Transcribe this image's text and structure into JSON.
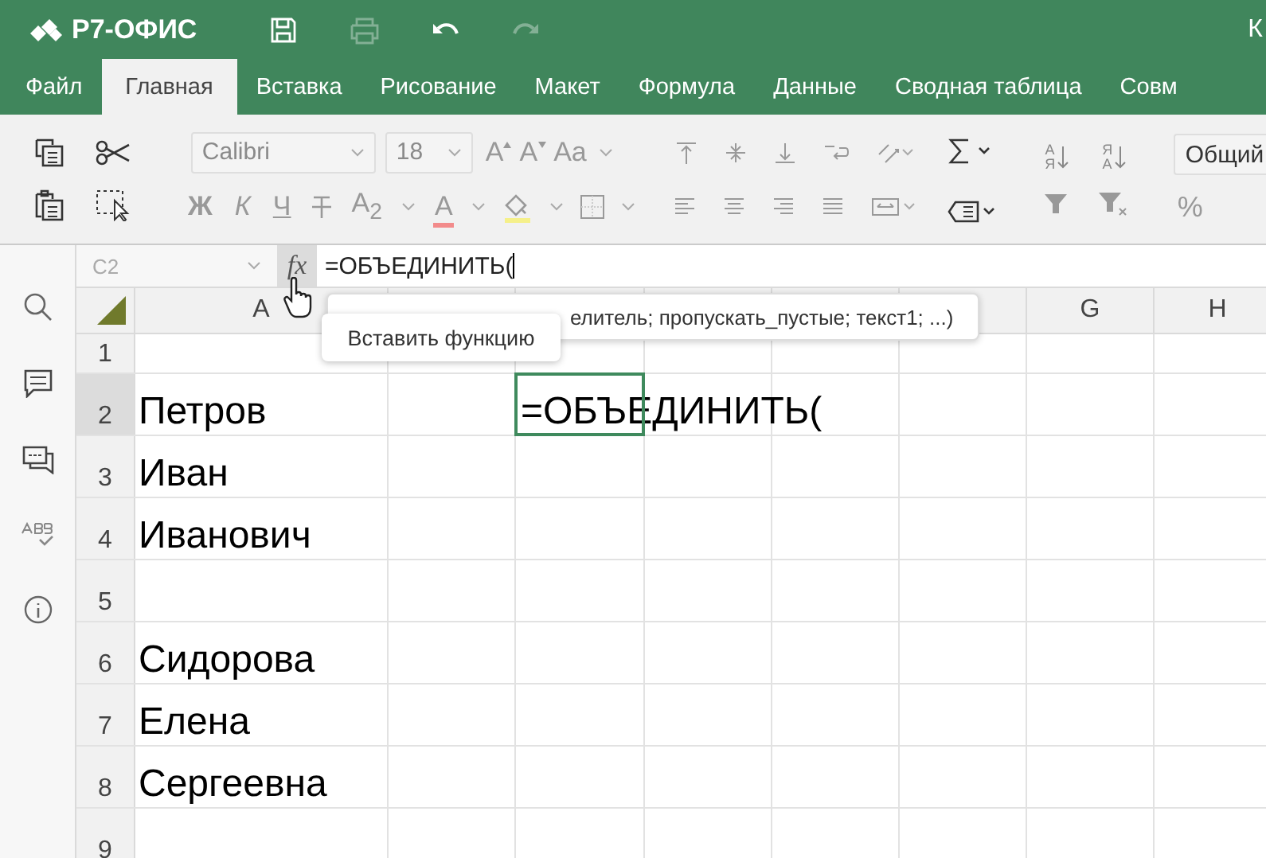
{
  "header": {
    "logo": "Р7-ОФИС",
    "title": "К",
    "print_disabled": true,
    "redo_disabled": true
  },
  "tabs": [
    {
      "label": "Файл",
      "selected": false
    },
    {
      "label": "Главная",
      "selected": true
    },
    {
      "label": "Вставка",
      "selected": false
    },
    {
      "label": "Рисование",
      "selected": false
    },
    {
      "label": "Макет",
      "selected": false
    },
    {
      "label": "Формула",
      "selected": false
    },
    {
      "label": "Данные",
      "selected": false
    },
    {
      "label": "Сводная таблица",
      "selected": false
    },
    {
      "label": "Совм",
      "selected": false
    }
  ],
  "toolbar": {
    "font_disabled": true,
    "font": "Calibri",
    "size": "18",
    "grow_font": "A",
    "shrink_font": "A",
    "change_case": "Aa",
    "bold": "Ж",
    "italic": "К",
    "underline": "Ч",
    "subscript": "A$_{2}$",
    "font_color": {
      "label": "A",
      "color": "#f28b8b"
    },
    "fill_color": {
      "color": "#f5f08a"
    },
    "sort_ascending": {
      "top": "А",
      "bottom": "Я"
    },
    "sort_descending": {
      "top": "Я",
      "bottom": "А"
    },
    "number_format": "Общий",
    "percent": "%"
  },
  "formula_bar": {
    "name_box": "C2",
    "fx": "fx",
    "formula": "=ОБЪЕДИНИТЬ("
  },
  "active_cell_text": "=ОБЪЕДИНИТЬ(",
  "function_hint": "елитель; пропускать_пустые; текст1; ...)",
  "tooltip": "Вставить функцию",
  "columns": [
    {
      "kind": "label",
      "label": "A",
      "selected": false
    },
    {
      "kind": "covered"
    },
    {
      "kind": "covered"
    },
    {
      "kind": "covered"
    },
    {
      "kind": "covered"
    },
    {
      "kind": "covered"
    },
    {
      "kind": "label",
      "label": "G",
      "selected": false
    },
    {
      "kind": "label",
      "label": "H",
      "selected": false
    }
  ],
  "rows": [
    {
      "number": "1",
      "selected": false
    },
    {
      "number": "2",
      "selected": true,
      "text": "Петров"
    },
    {
      "number": "3",
      "selected": false,
      "text": "Иван"
    },
    {
      "number": "4",
      "selected": false,
      "text": "Иванович"
    },
    {
      "number": "5",
      "selected": false
    },
    {
      "number": "6",
      "selected": false,
      "text": "Сидорова"
    },
    {
      "number": "7",
      "selected": false,
      "text": "Елена"
    },
    {
      "number": "8",
      "selected": false,
      "text": "Сергеевна"
    },
    {
      "number": "9",
      "selected": false
    }
  ]
}
